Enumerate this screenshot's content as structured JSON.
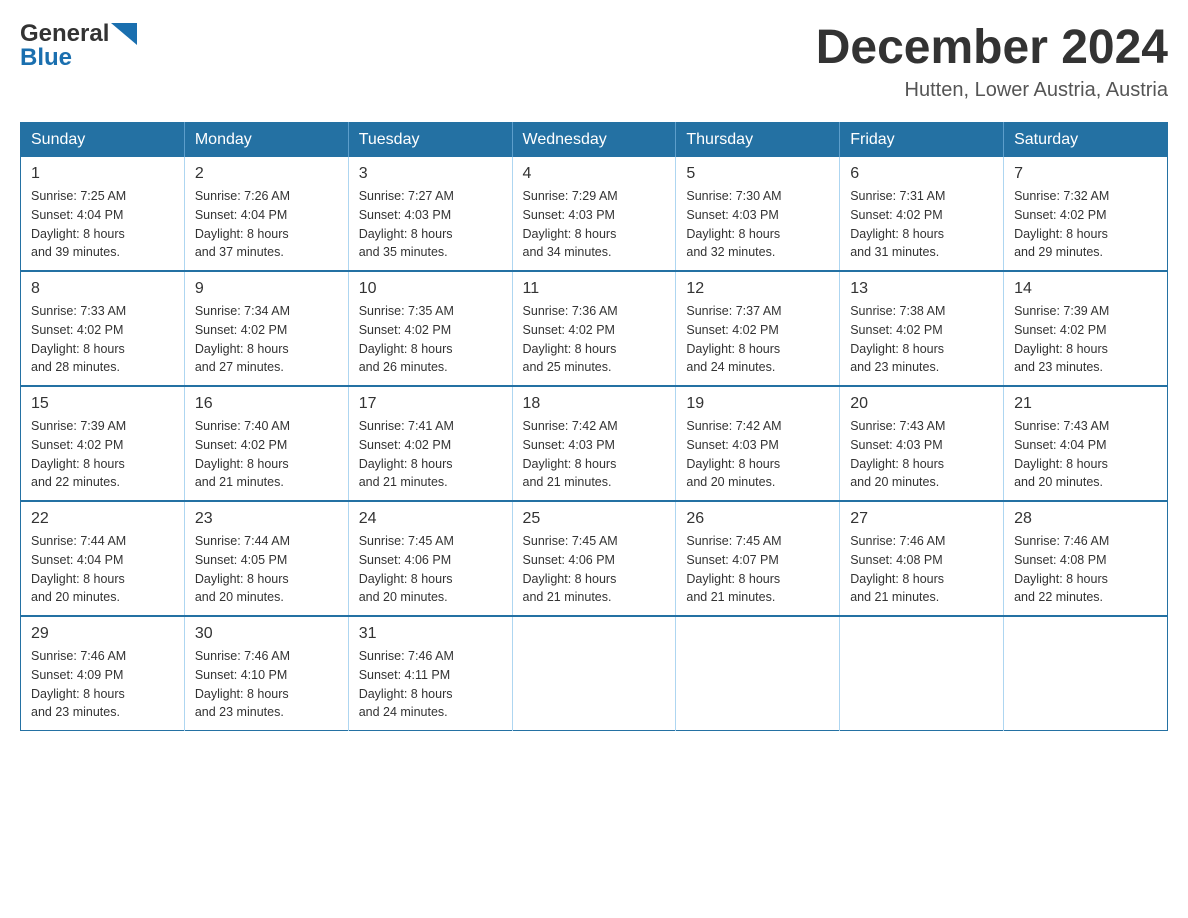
{
  "logo": {
    "general": "General",
    "blue": "Blue"
  },
  "title": {
    "month_year": "December 2024",
    "location": "Hutten, Lower Austria, Austria"
  },
  "days_of_week": [
    "Sunday",
    "Monday",
    "Tuesday",
    "Wednesday",
    "Thursday",
    "Friday",
    "Saturday"
  ],
  "weeks": [
    [
      {
        "day": "1",
        "sunrise": "Sunrise: 7:25 AM",
        "sunset": "Sunset: 4:04 PM",
        "daylight": "Daylight: 8 hours",
        "daylight2": "and 39 minutes."
      },
      {
        "day": "2",
        "sunrise": "Sunrise: 7:26 AM",
        "sunset": "Sunset: 4:04 PM",
        "daylight": "Daylight: 8 hours",
        "daylight2": "and 37 minutes."
      },
      {
        "day": "3",
        "sunrise": "Sunrise: 7:27 AM",
        "sunset": "Sunset: 4:03 PM",
        "daylight": "Daylight: 8 hours",
        "daylight2": "and 35 minutes."
      },
      {
        "day": "4",
        "sunrise": "Sunrise: 7:29 AM",
        "sunset": "Sunset: 4:03 PM",
        "daylight": "Daylight: 8 hours",
        "daylight2": "and 34 minutes."
      },
      {
        "day": "5",
        "sunrise": "Sunrise: 7:30 AM",
        "sunset": "Sunset: 4:03 PM",
        "daylight": "Daylight: 8 hours",
        "daylight2": "and 32 minutes."
      },
      {
        "day": "6",
        "sunrise": "Sunrise: 7:31 AM",
        "sunset": "Sunset: 4:02 PM",
        "daylight": "Daylight: 8 hours",
        "daylight2": "and 31 minutes."
      },
      {
        "day": "7",
        "sunrise": "Sunrise: 7:32 AM",
        "sunset": "Sunset: 4:02 PM",
        "daylight": "Daylight: 8 hours",
        "daylight2": "and 29 minutes."
      }
    ],
    [
      {
        "day": "8",
        "sunrise": "Sunrise: 7:33 AM",
        "sunset": "Sunset: 4:02 PM",
        "daylight": "Daylight: 8 hours",
        "daylight2": "and 28 minutes."
      },
      {
        "day": "9",
        "sunrise": "Sunrise: 7:34 AM",
        "sunset": "Sunset: 4:02 PM",
        "daylight": "Daylight: 8 hours",
        "daylight2": "and 27 minutes."
      },
      {
        "day": "10",
        "sunrise": "Sunrise: 7:35 AM",
        "sunset": "Sunset: 4:02 PM",
        "daylight": "Daylight: 8 hours",
        "daylight2": "and 26 minutes."
      },
      {
        "day": "11",
        "sunrise": "Sunrise: 7:36 AM",
        "sunset": "Sunset: 4:02 PM",
        "daylight": "Daylight: 8 hours",
        "daylight2": "and 25 minutes."
      },
      {
        "day": "12",
        "sunrise": "Sunrise: 7:37 AM",
        "sunset": "Sunset: 4:02 PM",
        "daylight": "Daylight: 8 hours",
        "daylight2": "and 24 minutes."
      },
      {
        "day": "13",
        "sunrise": "Sunrise: 7:38 AM",
        "sunset": "Sunset: 4:02 PM",
        "daylight": "Daylight: 8 hours",
        "daylight2": "and 23 minutes."
      },
      {
        "day": "14",
        "sunrise": "Sunrise: 7:39 AM",
        "sunset": "Sunset: 4:02 PM",
        "daylight": "Daylight: 8 hours",
        "daylight2": "and 23 minutes."
      }
    ],
    [
      {
        "day": "15",
        "sunrise": "Sunrise: 7:39 AM",
        "sunset": "Sunset: 4:02 PM",
        "daylight": "Daylight: 8 hours",
        "daylight2": "and 22 minutes."
      },
      {
        "day": "16",
        "sunrise": "Sunrise: 7:40 AM",
        "sunset": "Sunset: 4:02 PM",
        "daylight": "Daylight: 8 hours",
        "daylight2": "and 21 minutes."
      },
      {
        "day": "17",
        "sunrise": "Sunrise: 7:41 AM",
        "sunset": "Sunset: 4:02 PM",
        "daylight": "Daylight: 8 hours",
        "daylight2": "and 21 minutes."
      },
      {
        "day": "18",
        "sunrise": "Sunrise: 7:42 AM",
        "sunset": "Sunset: 4:03 PM",
        "daylight": "Daylight: 8 hours",
        "daylight2": "and 21 minutes."
      },
      {
        "day": "19",
        "sunrise": "Sunrise: 7:42 AM",
        "sunset": "Sunset: 4:03 PM",
        "daylight": "Daylight: 8 hours",
        "daylight2": "and 20 minutes."
      },
      {
        "day": "20",
        "sunrise": "Sunrise: 7:43 AM",
        "sunset": "Sunset: 4:03 PM",
        "daylight": "Daylight: 8 hours",
        "daylight2": "and 20 minutes."
      },
      {
        "day": "21",
        "sunrise": "Sunrise: 7:43 AM",
        "sunset": "Sunset: 4:04 PM",
        "daylight": "Daylight: 8 hours",
        "daylight2": "and 20 minutes."
      }
    ],
    [
      {
        "day": "22",
        "sunrise": "Sunrise: 7:44 AM",
        "sunset": "Sunset: 4:04 PM",
        "daylight": "Daylight: 8 hours",
        "daylight2": "and 20 minutes."
      },
      {
        "day": "23",
        "sunrise": "Sunrise: 7:44 AM",
        "sunset": "Sunset: 4:05 PM",
        "daylight": "Daylight: 8 hours",
        "daylight2": "and 20 minutes."
      },
      {
        "day": "24",
        "sunrise": "Sunrise: 7:45 AM",
        "sunset": "Sunset: 4:06 PM",
        "daylight": "Daylight: 8 hours",
        "daylight2": "and 20 minutes."
      },
      {
        "day": "25",
        "sunrise": "Sunrise: 7:45 AM",
        "sunset": "Sunset: 4:06 PM",
        "daylight": "Daylight: 8 hours",
        "daylight2": "and 21 minutes."
      },
      {
        "day": "26",
        "sunrise": "Sunrise: 7:45 AM",
        "sunset": "Sunset: 4:07 PM",
        "daylight": "Daylight: 8 hours",
        "daylight2": "and 21 minutes."
      },
      {
        "day": "27",
        "sunrise": "Sunrise: 7:46 AM",
        "sunset": "Sunset: 4:08 PM",
        "daylight": "Daylight: 8 hours",
        "daylight2": "and 21 minutes."
      },
      {
        "day": "28",
        "sunrise": "Sunrise: 7:46 AM",
        "sunset": "Sunset: 4:08 PM",
        "daylight": "Daylight: 8 hours",
        "daylight2": "and 22 minutes."
      }
    ],
    [
      {
        "day": "29",
        "sunrise": "Sunrise: 7:46 AM",
        "sunset": "Sunset: 4:09 PM",
        "daylight": "Daylight: 8 hours",
        "daylight2": "and 23 minutes."
      },
      {
        "day": "30",
        "sunrise": "Sunrise: 7:46 AM",
        "sunset": "Sunset: 4:10 PM",
        "daylight": "Daylight: 8 hours",
        "daylight2": "and 23 minutes."
      },
      {
        "day": "31",
        "sunrise": "Sunrise: 7:46 AM",
        "sunset": "Sunset: 4:11 PM",
        "daylight": "Daylight: 8 hours",
        "daylight2": "and 24 minutes."
      },
      null,
      null,
      null,
      null
    ]
  ]
}
